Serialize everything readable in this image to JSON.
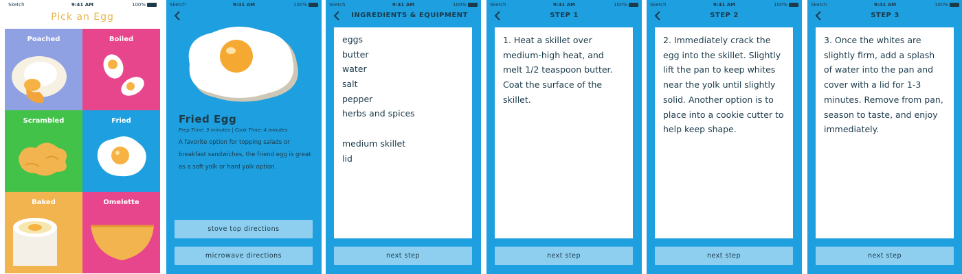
{
  "status": {
    "carrier": "Sketch",
    "time": "9:41 AM",
    "battery": "100%"
  },
  "pick": {
    "title": "Pick an Egg",
    "tiles": [
      {
        "label": "Poached",
        "color": "#8fa1e2"
      },
      {
        "label": "Boiled",
        "color": "#e8468c"
      },
      {
        "label": "Scrambled",
        "color": "#43c24a"
      },
      {
        "label": "Fried",
        "color": "#1e9fdf"
      },
      {
        "label": "Baked",
        "color": "#f2b44e"
      },
      {
        "label": "Omelette",
        "color": "#e8468c"
      }
    ]
  },
  "detail": {
    "title": "Fried Egg",
    "meta": "Prep Time: 5 minutes | Cook Time: 4 minutes",
    "description": "A favorite option for topping salads or breakfast sandwiches, the friend egg is great as a soft yolk or hard yolk option.",
    "stove_button": "stove top directions",
    "microwave_button": "microwave directions"
  },
  "ingredients": {
    "title": "INGREDIENTS & EQUIPMENT",
    "items": [
      "eggs",
      "butter",
      "water",
      "salt",
      "pepper",
      "herbs and spices",
      "",
      "medium skillet",
      "lid"
    ]
  },
  "steps": [
    {
      "title": "STEP 1",
      "text": "1. Heat a skillet over medium-high heat, and melt 1/2 teaspoon butter. Coat the surface of the skillet."
    },
    {
      "title": "STEP 2",
      "text": "2. Immediately crack the egg into the skillet. Slightly lift the pan to keep whites near the yolk until slightly solid. Another option is to place into a cookie cutter to help keep shape."
    },
    {
      "title": "STEP 3",
      "text": "3. Once the whites are slightly firm, add a splash of water into the pan and cover with a lid for 1-3 minutes. Remove from pan, season to taste, and enjoy immediately."
    }
  ],
  "next_step_label": "next step",
  "colors": {
    "app_blue": "#1e9fdf",
    "button_blue": "#8ecff0",
    "title_yellow": "#e9b44c",
    "text_dark": "#1b3a4a"
  }
}
